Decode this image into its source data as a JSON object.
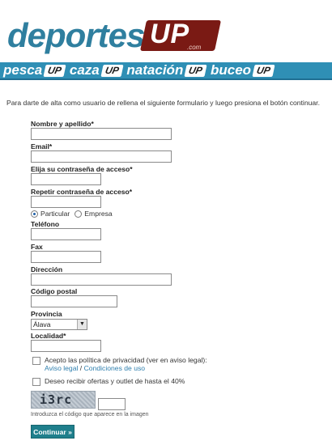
{
  "header": {
    "logo_word": "deportes",
    "logo_up": "UP",
    "logo_com": ".com"
  },
  "banner": {
    "items": [
      {
        "word": "pesca",
        "badge": "UP"
      },
      {
        "word": "caza",
        "badge": "UP"
      },
      {
        "word": "natación",
        "badge": "UP"
      },
      {
        "word": "buceo",
        "badge": "UP"
      }
    ]
  },
  "intro": "Para darte de alta como usuario de rellena el siguiente formulario y luego presiona el botón continuar.",
  "form": {
    "name_label": "Nombre y apellido*",
    "name_value": "",
    "email_label": "Email*",
    "email_value": "",
    "password_label": "Elija su contraseña de acceso*",
    "password_value": "",
    "password_repeat_label": "Repetir contraseña de acceso*",
    "password_repeat_value": "",
    "account_type": {
      "options": [
        "Particular",
        "Empresa"
      ],
      "selected": "Particular"
    },
    "phone_label": "Teléfono",
    "phone_value": "",
    "fax_label": "Fax",
    "fax_value": "",
    "address_label": "Dirección",
    "address_value": "",
    "postal_label": "Código postal",
    "postal_value": "",
    "province_label": "Provincia",
    "province_selected": "Álava",
    "locality_label": "Localidad*",
    "locality_value": "",
    "privacy_text": "Acepto las política de privacidad (ver en aviso legal):",
    "privacy_link_legal": "Aviso legal",
    "privacy_sep": " / ",
    "privacy_link_terms": "Condiciones de uso",
    "offers_text": "Deseo recibir ofertas y outlet de hasta el 40%",
    "captcha_code": "i3rc",
    "captcha_hint": "Introduzca el código que aparece en la imagen",
    "submit_label": "Continuar »"
  }
}
